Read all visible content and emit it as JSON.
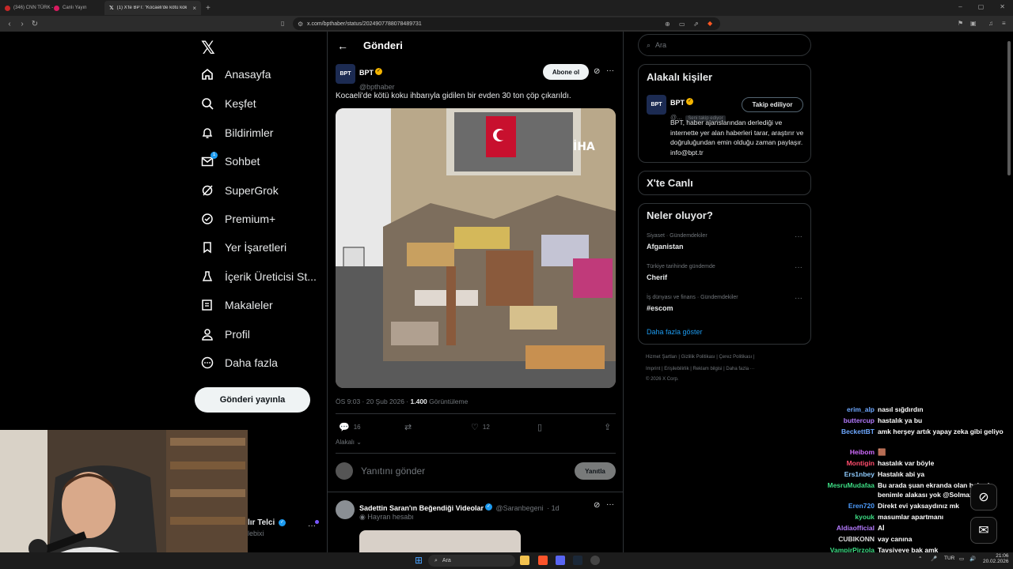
{
  "browser": {
    "tabs": [
      {
        "label": "(346) CNN TÜRK - ",
        "active": false
      },
      {
        "label": "Canlı Yayın ",
        "active": false
      },
      {
        "label": "(1) X'te BPT: \"Kocaeli'de kötü koku",
        "active": true
      }
    ],
    "url": "x.com/bpthaber/status/2024907788078489731"
  },
  "nav": {
    "items": [
      {
        "label": "Anasayfa",
        "icon": "home-icon"
      },
      {
        "label": "Keşfet",
        "icon": "search-icon"
      },
      {
        "label": "Bildirimler",
        "icon": "bell-icon"
      },
      {
        "label": "Sohbet",
        "icon": "mail-icon",
        "badge": "1"
      },
      {
        "label": "SuperGrok",
        "icon": "grok-icon"
      },
      {
        "label": "Premium+",
        "icon": "premium-icon"
      },
      {
        "label": "Yer İşaretleri",
        "icon": "bookmark-icon"
      },
      {
        "label": "İçerik Üreticisi St...",
        "icon": "creator-studio-icon"
      },
      {
        "label": "Makaleler",
        "icon": "articles-icon"
      },
      {
        "label": "Profil",
        "icon": "profile-icon"
      },
      {
        "label": "Daha fazla",
        "icon": "more-icon"
      }
    ],
    "post_button": "Gönderi yayınla",
    "account_name_partial": "lır Telci",
    "account_handle_partial": "lebixi"
  },
  "post": {
    "header_title": "Gönderi",
    "author_name": "BPT",
    "author_handle": "@bpthaber",
    "avatar_text": "BPT",
    "subscribe_label": "Abone ol",
    "text": "Kocaeli'de kötü koku ihbarıyla gidilen bir evden 30 ton çöp çıkarıldı.",
    "media_watermark": "İHA",
    "time": "ÖS 9:03 · 20 Şub 2026 · ",
    "views_count": "1.400",
    "views_label": " Görüntüleme",
    "replies": "16",
    "likes": "12",
    "related_label": "Alakalı",
    "reply_placeholder": "Yanıtını gönder",
    "reply_button": "Yanıtla"
  },
  "next_post": {
    "author_name": "Sadettin Saran'ın Beğendiği Videolar",
    "author_handle": "@Saranbegeni",
    "time": "· 1d",
    "subtitle": "Hayran hesabı"
  },
  "right": {
    "search_placeholder": "Ara",
    "related_people_title": "Alakalı kişiler",
    "person_name": "BPT",
    "person_handle": "@...",
    "person_follows_you": "Seni takip ediyor",
    "follow_button": "Takip ediliyor",
    "person_bio": "BPT, haber ajanslarından derlediği ve internette yer alan haberleri tarar, araştırır ve doğruluğundan emin olduğu zaman paylaşır. info@bpt.tr",
    "live_title": "X'te Canlı",
    "trends_title": "Neler oluyor?",
    "trends": [
      {
        "context": "Siyaset · Gündemdekiler",
        "name": "Afganistan"
      },
      {
        "context": "Türkiye tarihinde gündemde",
        "name": "Cherif"
      },
      {
        "context": "İş dünyası ve finans · Gündemdekiler",
        "name": "#escom"
      }
    ],
    "show_more": "Daha fazla göster",
    "footer_line1": "Hizmet Şartları  |  Gizlilik Politikası  |  Çerez Politikası  |",
    "footer_line2": "Imprint  |  Erişilebilirlik  |  Reklam bilgisi  |  Daha fazla ···",
    "footer_line3": "© 2026 X Corp."
  },
  "chat": [
    {
      "user": "erim_alp",
      "color": "#6ea8ff",
      "msg": "nasıl sığdırdın"
    },
    {
      "user": "buttercup",
      "color": "#b57bff",
      "msg": "hastalık ya bu"
    },
    {
      "user": "BeckettBT",
      "color": "#6ea8ff",
      "msg": "amk herşey artık yapay zeka gibi geliyo"
    },
    {
      "user": "Heibom",
      "color": "#d16bff",
      "msg": "🟫"
    },
    {
      "user": "Montigin",
      "color": "#ff4d6d",
      "msg": "hastalık var böyle"
    },
    {
      "user": "Ers1nbey",
      "color": "#8ecbff",
      "msg": "Hastalık abi ya"
    },
    {
      "user": "MesruMudafaa",
      "color": "#3ddc84",
      "msg": "Bu arada şuan ekranda olan haberin benimle alakası yok @Solmazzzz"
    },
    {
      "user": "Eren720",
      "color": "#4d9dff",
      "msg": "Direkt evi yaksaydınız mk"
    },
    {
      "user": "kyouk",
      "color": "#3ddc84",
      "msg": "masumlar apartmanı"
    },
    {
      "user": "Aldiaofficial",
      "color": "#b57bff",
      "msg": "Aİ"
    },
    {
      "user": "CUBIKONN",
      "color": "#dddddd",
      "msg": "vay canına"
    },
    {
      "user": "VampirPirzola",
      "color": "#3ddc84",
      "msg": "Tavsiyeye bak amk"
    },
    {
      "user": "Heibom",
      "color": "#d16bff",
      "msg": "🟫"
    }
  ],
  "taskbar": {
    "search": "Ara",
    "lang": "TUR",
    "time": "21:06",
    "date": "20.02.2026"
  }
}
